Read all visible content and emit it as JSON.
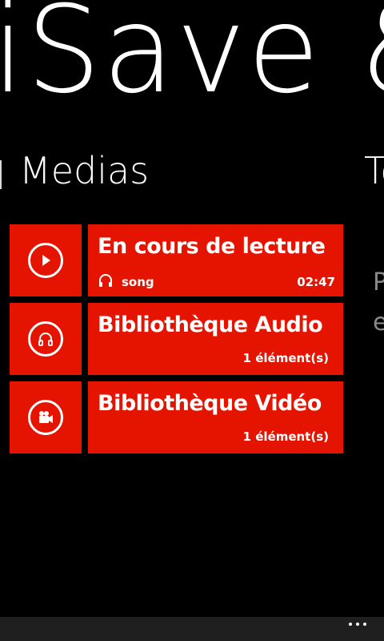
{
  "app": {
    "title": "iSave & "
  },
  "pivot": {
    "current": "Medias",
    "next": "To",
    "peek_lines": [
      "P",
      "e"
    ]
  },
  "items": [
    {
      "title": "En cours de lecture",
      "icon": "play-icon",
      "meta_icon": "headphones-icon",
      "meta_text": "song",
      "meta_right": "02:47"
    },
    {
      "title": "Bibliothèque Audio",
      "icon": "headphones-icon",
      "count": "1 élément(s)"
    },
    {
      "title": "Bibliothèque Vidéo",
      "icon": "video-camera-icon",
      "count": "1 élément(s)"
    }
  ],
  "colors": {
    "accent": "#e51400",
    "background": "#000000",
    "app_bar": "#1f1f1f"
  },
  "app_bar": {
    "more_icon": "more-icon"
  }
}
